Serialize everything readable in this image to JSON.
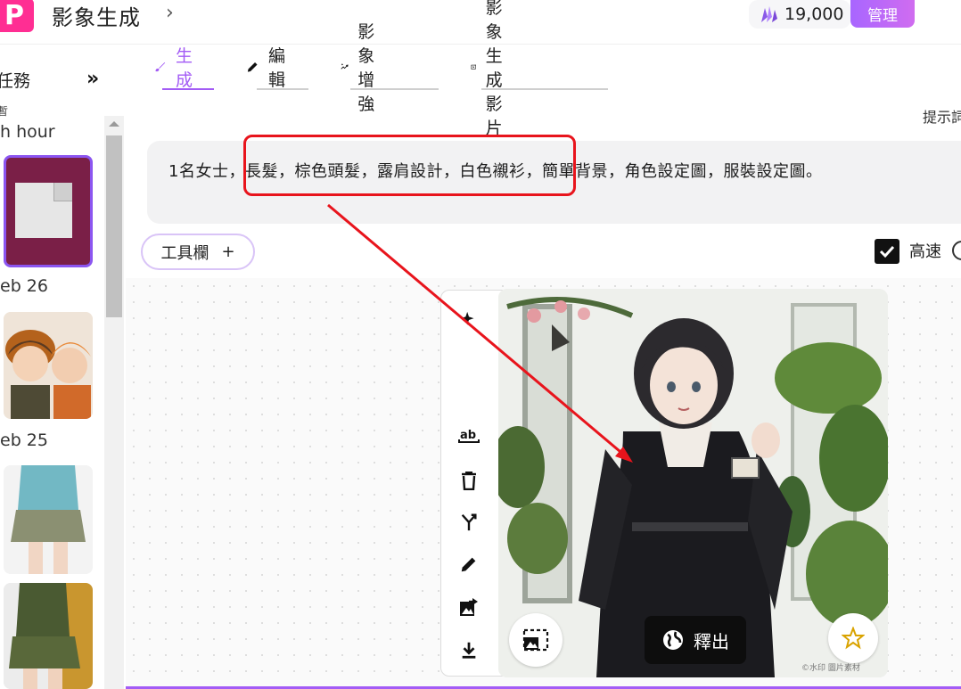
{
  "header": {
    "logo_letter": "P",
    "title": "影象生成",
    "credits": "19,000",
    "manage_label": "管理",
    "brand_color": "#ff2e93",
    "accent_color": "#a35cf5"
  },
  "sidebar": {
    "heading": "任務",
    "mini_label": "暫",
    "groups": [
      {
        "label": "h hour"
      },
      {
        "label": "eb 26"
      },
      {
        "label": "eb 25"
      }
    ]
  },
  "tabs": [
    {
      "label": "生成",
      "icon": "brush-icon",
      "active": true
    },
    {
      "label": "編輯",
      "icon": "pencil-icon",
      "active": false
    },
    {
      "label": "影象增強",
      "icon": "enhance-icon",
      "active": false
    },
    {
      "label": "影象生成影片",
      "icon": "video-icon",
      "active": false
    }
  ],
  "hint_right": "提示詞",
  "prompt": {
    "text": "1名女士，長髮，棕色頭髮，露肩設計，白色襯衫，簡單背景，角色設定圖，服裝設定圖。"
  },
  "toolbar": {
    "label": "工具欄",
    "plus": "+"
  },
  "fast": {
    "label": "高速",
    "checked": true
  },
  "image_card": {
    "release_label": "釋出",
    "watermark": "©水印 圖片素材",
    "tools": [
      "magic-icon",
      "text-ab-icon",
      "trash-icon",
      "branch-icon",
      "pencil-icon",
      "image-export-icon",
      "download-icon"
    ]
  },
  "annotation_color": "#e8141c"
}
